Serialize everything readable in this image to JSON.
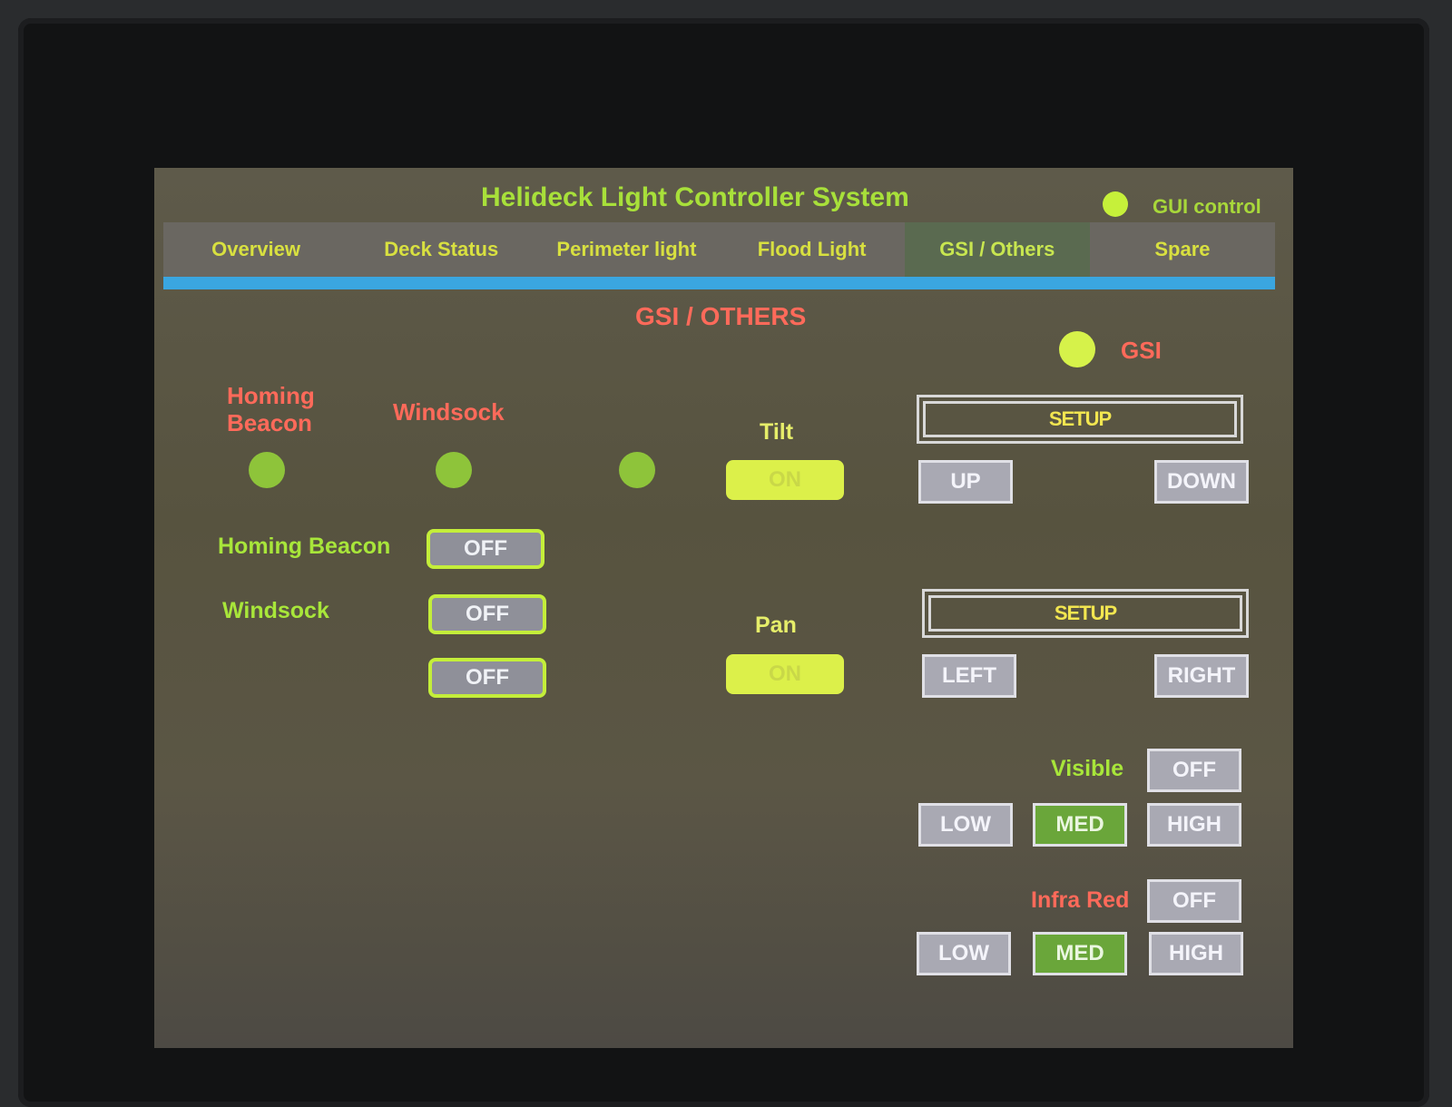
{
  "header": {
    "title": "Helideck Light Controller System",
    "gui_control_label": "GUI control"
  },
  "tabs": [
    {
      "label": "Overview"
    },
    {
      "label": "Deck Status"
    },
    {
      "label": "Perimeter light"
    },
    {
      "label": "Flood Light"
    },
    {
      "label": "GSI / Others",
      "active": true
    },
    {
      "label": "Spare"
    }
  ],
  "page": {
    "section_title": "GSI / OTHERS",
    "gsi_label": "GSI",
    "status_labels": {
      "homing_beacon": "Homing\nBeacon",
      "windsock": "Windsock"
    },
    "controls": {
      "homing_beacon_label": "Homing Beacon",
      "homing_beacon_state": "OFF",
      "windsock_label": "Windsock",
      "windsock_state": "OFF",
      "third_state": "OFF"
    },
    "tilt": {
      "label": "Tilt",
      "state": "ON",
      "setup_label": "SETUP",
      "up_label": "UP",
      "down_label": "DOWN"
    },
    "pan": {
      "label": "Pan",
      "state": "ON",
      "setup_label": "SETUP",
      "left_label": "LEFT",
      "right_label": "RIGHT"
    },
    "visible": {
      "label": "Visible",
      "off_label": "OFF",
      "low_label": "LOW",
      "med_label": "MED",
      "high_label": "HIGH",
      "selected": "MED"
    },
    "infra_red": {
      "label": "Infra Red",
      "off_label": "OFF",
      "low_label": "LOW",
      "med_label": "MED",
      "high_label": "HIGH",
      "selected": "MED"
    }
  },
  "colors": {
    "accent_green": "#a8e63a",
    "alarm_red": "#ff6a5a",
    "tab_underline": "#3aa6e0"
  }
}
